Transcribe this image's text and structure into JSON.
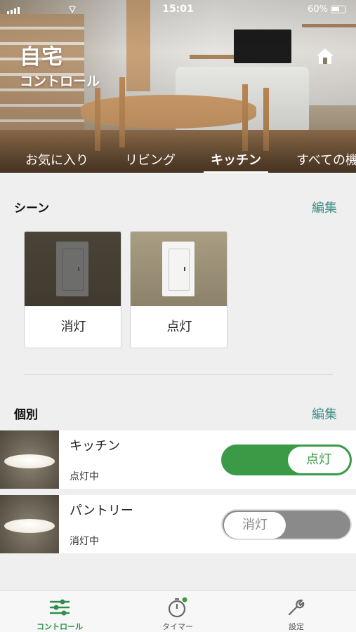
{
  "status_bar": {
    "time": "15:01",
    "battery": "60%"
  },
  "header": {
    "title": "自宅",
    "subtitle": "コントロール"
  },
  "tabs": [
    {
      "label": "お気に入り",
      "active": false
    },
    {
      "label": "リビング",
      "active": false
    },
    {
      "label": "キッチン",
      "active": true
    },
    {
      "label": "すべての機",
      "active": false
    }
  ],
  "scenes": {
    "title": "シーン",
    "edit": "編集",
    "items": [
      {
        "label": "消灯"
      },
      {
        "label": "点灯"
      }
    ]
  },
  "devices": {
    "title": "個別",
    "edit": "編集",
    "items": [
      {
        "name": "キッチン",
        "state": "点灯中",
        "toggle_label": "点灯",
        "on": true
      },
      {
        "name": "パントリー",
        "state": "消灯中",
        "toggle_label": "消灯",
        "on": false
      }
    ]
  },
  "bottom_nav": [
    {
      "label": "コントロール",
      "active": true,
      "icon": "sliders-icon"
    },
    {
      "label": "タイマー",
      "active": false,
      "icon": "timer-icon"
    },
    {
      "label": "設定",
      "active": false,
      "icon": "wrench-icon"
    }
  ],
  "colors": {
    "accent_green": "#3a9a46",
    "edit_teal": "#3d8f86",
    "toggle_off": "#8a8a8a"
  }
}
